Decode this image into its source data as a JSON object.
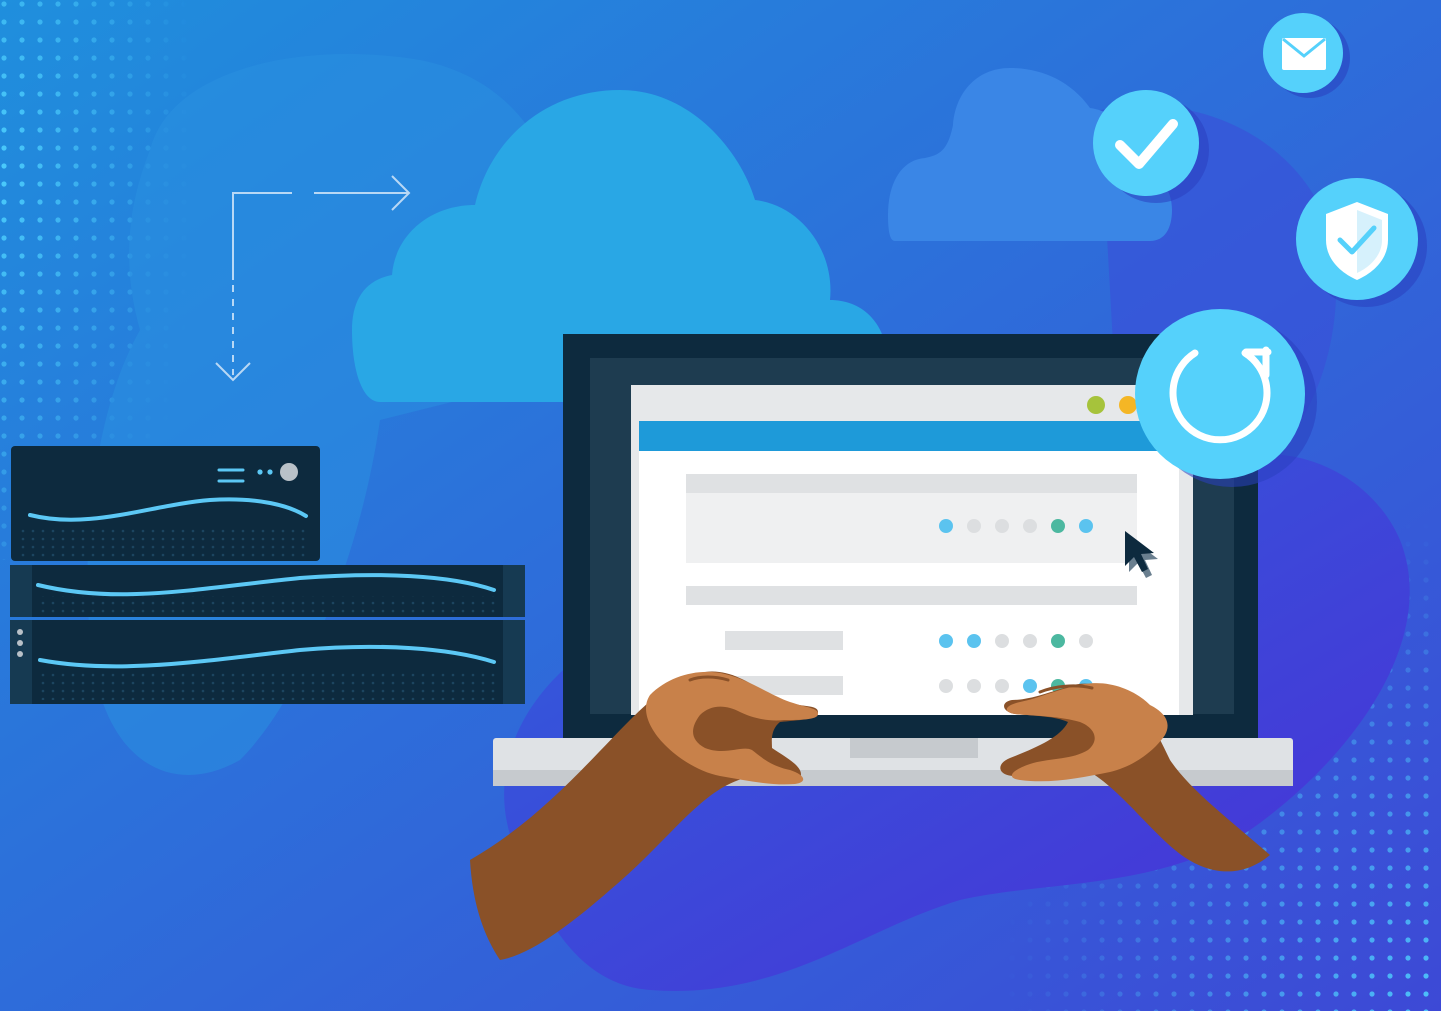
{
  "colors": {
    "background_start": "#1f8fdd",
    "background_end": "#3d49d6",
    "cloud_light": "#2aa7e6",
    "cloud_far": "#3a86e6",
    "blob_purple": "#4a2fd6",
    "dots": "#4fd2ff",
    "server_dark": "#0d2a3e",
    "server_wave": "#5cc8f5",
    "laptop_bezel": "#0d2a3e",
    "laptop_inner": "#1e3c50",
    "screen_header": "#1e9ad9",
    "icon_circle": "#55d1fb",
    "skin": "#c8814a",
    "skin_shadow": "#8a5128",
    "status_blue": "#5bc3ef",
    "status_green": "#4cb8a0",
    "status_grey": "#dcdee0",
    "window_green": "#a6c33b",
    "window_yellow": "#f4b625"
  },
  "icons": {
    "mail": "envelope-icon",
    "check": "checkmark-icon",
    "security": "shield-check-icon",
    "refresh": "refresh-icon",
    "cursor": "mouse-pointer-icon",
    "menu": "hamburger-icon"
  },
  "screen": {
    "row1_indicators": [
      "blue",
      "grey",
      "grey",
      "grey",
      "green",
      "blue"
    ],
    "row2_indicators": [
      "blue",
      "blue",
      "grey",
      "grey",
      "green",
      "grey"
    ],
    "row3_indicators": [
      "grey",
      "grey",
      "grey",
      "blue",
      "green",
      "blue"
    ]
  }
}
